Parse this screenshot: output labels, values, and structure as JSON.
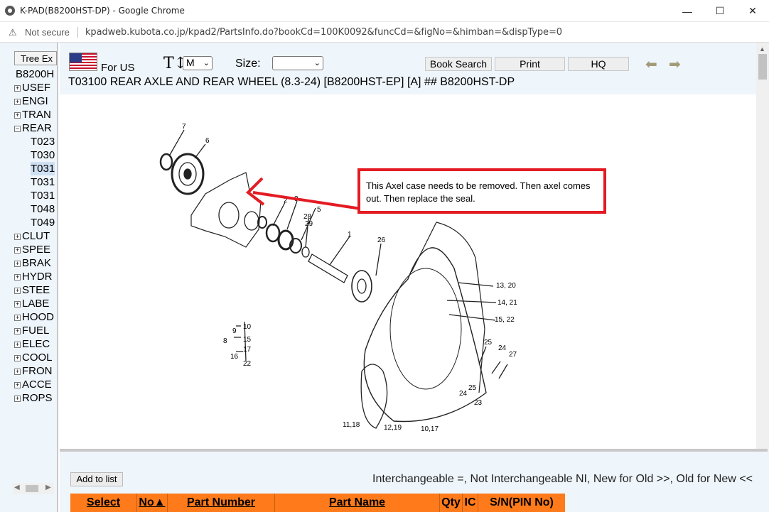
{
  "window": {
    "title": "K-PAD(B8200HST-DP) - Google Chrome",
    "minimize": "—",
    "maximize": "☐",
    "close": "✕"
  },
  "address": {
    "security": "Not secure",
    "url": "kpadweb.kubota.co.jp/kpad2/PartsInfo.do?bookCd=100K0092&funcCd=&figNo=&himban=&dispType=0"
  },
  "tree": {
    "button": "Tree Ex",
    "root": "B8200H",
    "items": [
      {
        "pm": "+",
        "label": "USEF"
      },
      {
        "pm": "+",
        "label": "ENGI"
      },
      {
        "pm": "+",
        "label": "TRAN"
      },
      {
        "pm": "−",
        "label": "REAR"
      },
      {
        "pm": "",
        "label": "T023"
      },
      {
        "pm": "",
        "label": "T030"
      },
      {
        "pm": "",
        "label": "T031"
      },
      {
        "pm": "",
        "label": "T031"
      },
      {
        "pm": "",
        "label": "T031"
      },
      {
        "pm": "",
        "label": "T048"
      },
      {
        "pm": "",
        "label": "T049"
      },
      {
        "pm": "+",
        "label": "CLUT"
      },
      {
        "pm": "+",
        "label": "SPEE"
      },
      {
        "pm": "+",
        "label": "BRAK"
      },
      {
        "pm": "+",
        "label": "HYDR"
      },
      {
        "pm": "+",
        "label": "STEE"
      },
      {
        "pm": "+",
        "label": "LABE"
      },
      {
        "pm": "+",
        "label": "HOOD"
      },
      {
        "pm": "+",
        "label": "FUEL"
      },
      {
        "pm": "+",
        "label": "ELEC"
      },
      {
        "pm": "+",
        "label": "COOL"
      },
      {
        "pm": "+",
        "label": "FRON"
      },
      {
        "pm": "+",
        "label": "ACCE"
      },
      {
        "pm": "+",
        "label": "ROPS"
      }
    ]
  },
  "header": {
    "region": "For US",
    "font_size_value": "M",
    "size_label": "Size:",
    "size_value": "",
    "buttons": {
      "book_search": "Book Search",
      "print": "Print",
      "hq": "HQ"
    },
    "title": "T03100 REAR AXLE AND REAR WHEEL (8.3-24) [B8200HST-EP] [A] ## B8200HST-DP"
  },
  "callout": {
    "text": "This Axel case needs to be removed. Then axel comes out. Then replace the seal."
  },
  "diagram_labels": [
    "7",
    "6",
    "3",
    "2",
    "28",
    "5",
    "29",
    "1",
    "26",
    "13, 20",
    "14, 21",
    "15, 22",
    "25",
    "24",
    "27",
    "25",
    "24",
    "23",
    "9",
    "10",
    "8",
    "15",
    "17",
    "16",
    "22",
    "11,18",
    "12,19",
    "10,17"
  ],
  "bottom": {
    "add_button": "Add to list",
    "legend": "Interchangeable =, Not Interchangeable NI, New for Old >>, Old for New <<",
    "columns": [
      "Select",
      "No▲",
      "Part Number",
      "Part Name",
      "Qty",
      "IC",
      "S/N(PIN No)"
    ]
  },
  "colors": {
    "accent_header": "#ff7a1a",
    "callout_border": "#e31b23",
    "panel_bg": "#eef5fb"
  }
}
